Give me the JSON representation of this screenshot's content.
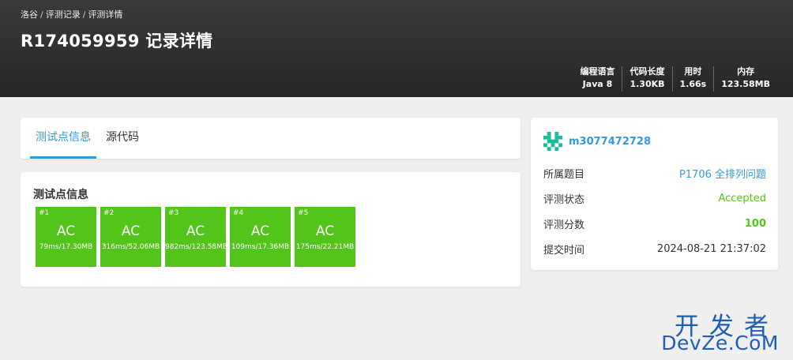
{
  "breadcrumb": [
    "洛谷",
    "评测记录",
    "评测详情"
  ],
  "title": "R174059959 记录详情",
  "stats": [
    {
      "label": "编程语言",
      "value": "Java 8"
    },
    {
      "label": "代码长度",
      "value": "1.30KB"
    },
    {
      "label": "用时",
      "value": "1.66s"
    },
    {
      "label": "内存",
      "value": "123.58MB"
    }
  ],
  "tabs": {
    "testcases": "测试点信息",
    "source": "源代码"
  },
  "testcases_title": "测试点信息",
  "testcases": [
    {
      "no": "#1",
      "result": "AC",
      "info": "79ms/17.30MB"
    },
    {
      "no": "#2",
      "result": "AC",
      "info": "316ms/52.06MB"
    },
    {
      "no": "#3",
      "result": "AC",
      "info": "982ms/123.58MB"
    },
    {
      "no": "#4",
      "result": "AC",
      "info": "109ms/17.36MB"
    },
    {
      "no": "#5",
      "result": "AC",
      "info": "175ms/22.21MB"
    }
  ],
  "user": {
    "name": "m3077472728",
    "avatar_icon": "identicon-avatar-icon"
  },
  "details": {
    "problem_label": "所属题目",
    "problem_value": "P1706 全排列问题",
    "status_label": "评测状态",
    "status_value": "Accepted",
    "score_label": "评测分数",
    "score_value": "100",
    "time_label": "提交时间",
    "time_value": "2024-08-21 21:37:02"
  },
  "watermark": {
    "cn": "开发者",
    "en": "DevZe.CoM"
  },
  "colors": {
    "accent": "#3498db",
    "ac_green": "#52c41a",
    "header_bg": "#2f2f2f",
    "page_bg": "#efefef",
    "watermark": "#1e5fb3"
  }
}
